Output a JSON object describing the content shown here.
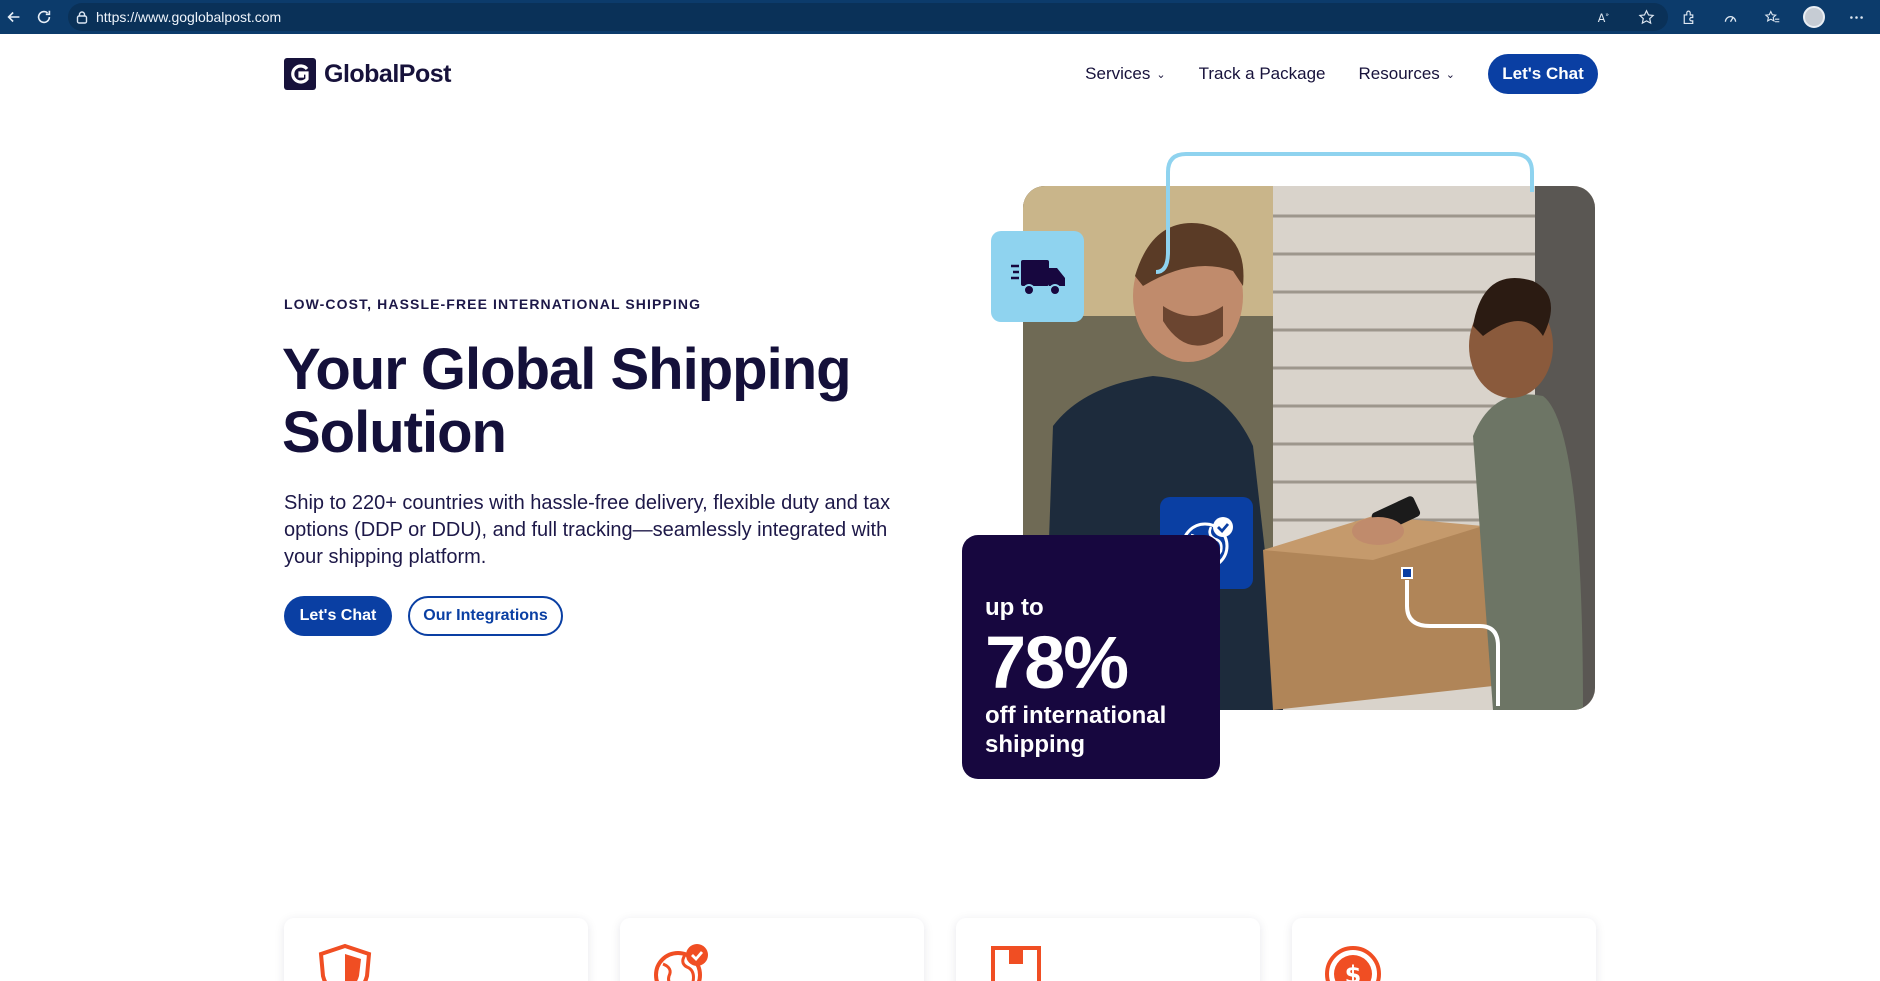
{
  "browser": {
    "url": "https://www.goglobalpost.com",
    "icons": [
      "back-icon",
      "refresh-icon",
      "lock-icon",
      "read-aloud-icon",
      "star-icon",
      "extensions-icon",
      "performance-icon",
      "favorites-icon",
      "profile-avatar",
      "more-icon"
    ]
  },
  "header": {
    "logo_text": "GlobalPost",
    "nav": {
      "services": "Services",
      "track": "Track a Package",
      "resources": "Resources",
      "chat": "Let's Chat"
    }
  },
  "hero": {
    "eyebrow": "LOW-COST, HASSLE-FREE INTERNATIONAL SHIPPING",
    "headline": "Your Global Shipping Solution",
    "lede": "Ship to 220+ countries with hassle-free delivery, flexible duty and tax options (DDP or DDU), and full tracking—seamlessly integrated with your shipping platform.",
    "cta_primary": "Let's Chat",
    "cta_secondary": "Our Integrations"
  },
  "promo": {
    "line1": "up to",
    "line2": "78%",
    "line3": "off international shipping"
  },
  "feature_icons": [
    "shield-icon",
    "globe-check-icon",
    "box-icon",
    "dollar-icon"
  ],
  "colors": {
    "brand_navy": "#17123b",
    "brand_blue": "#0a3fa3",
    "accent_orange": "#f04e23",
    "light_blue": "#8fd3ef",
    "promo_bg": "#17073f"
  }
}
